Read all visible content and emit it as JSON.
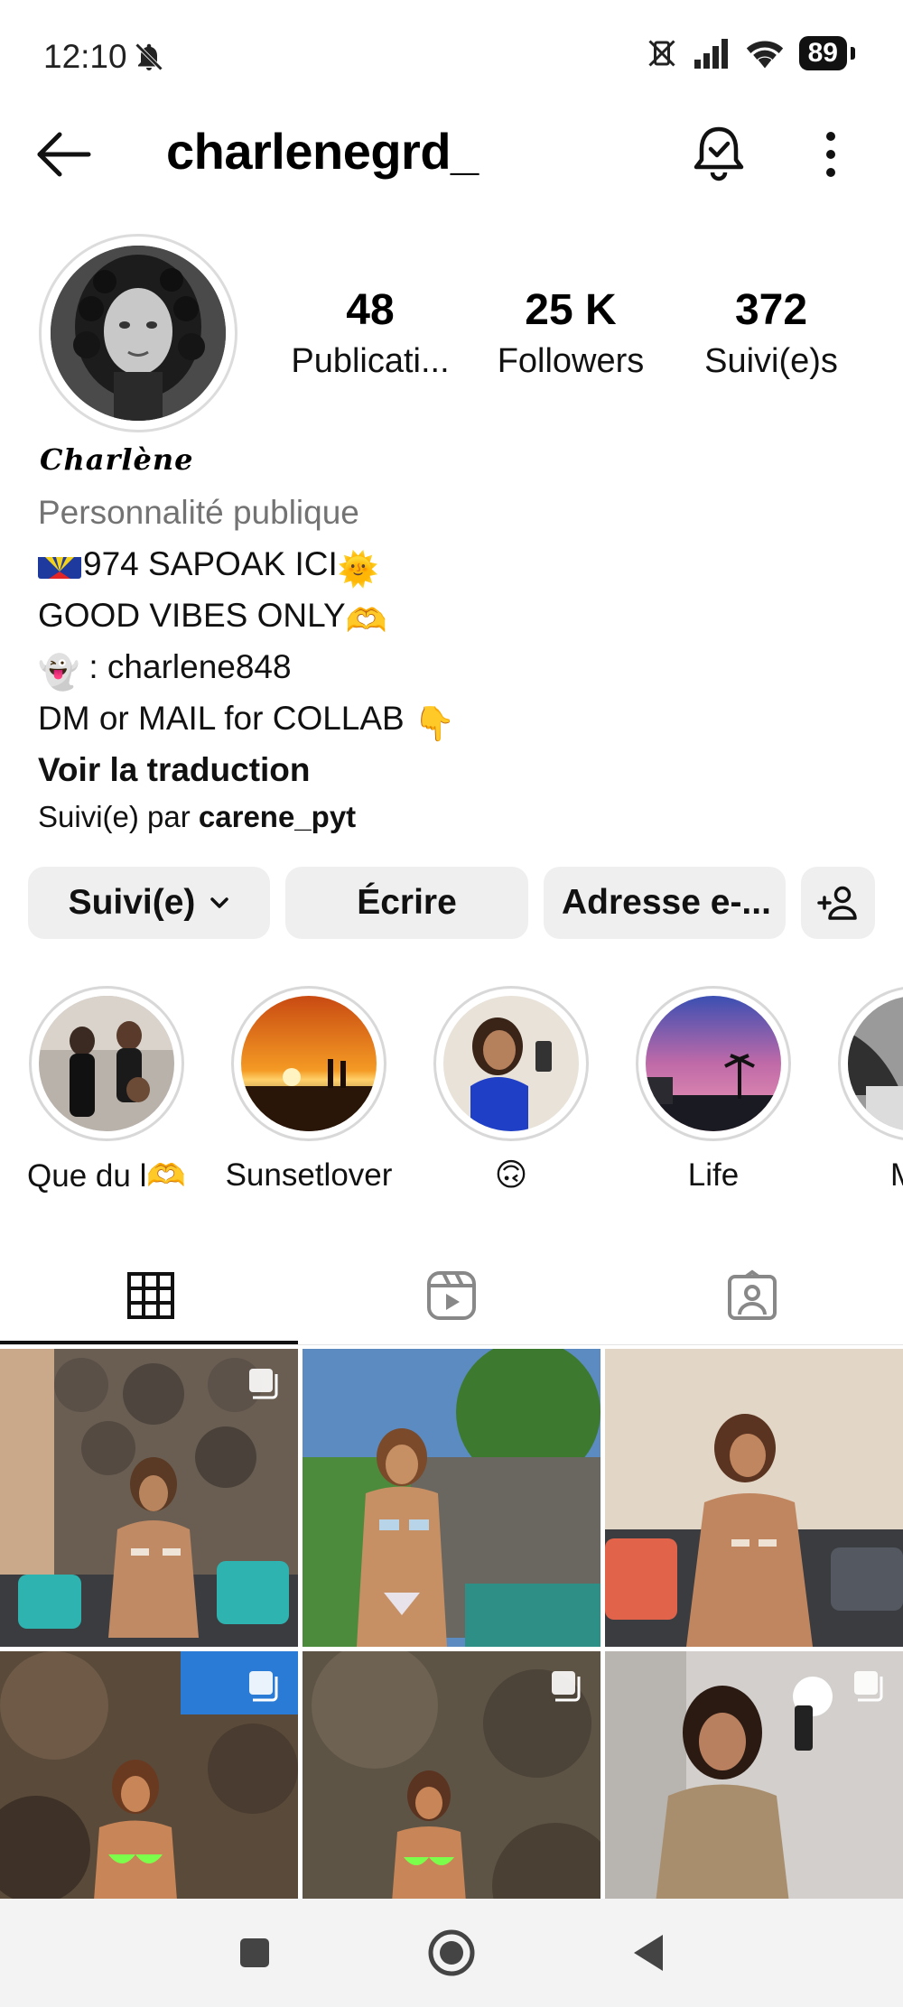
{
  "status_bar": {
    "time": "12:10",
    "battery": "89",
    "icons": [
      "notifications-muted-icon",
      "vibrate-icon",
      "signal-icon",
      "wifi-icon",
      "battery-icon"
    ]
  },
  "header": {
    "username": "charlenegrd_",
    "icons": [
      "back-arrow-icon",
      "bell-check-icon",
      "more-vertical-icon"
    ]
  },
  "profile": {
    "stats": [
      {
        "value": "48",
        "label": "Publicati..."
      },
      {
        "value": "25 K",
        "label": "Followers"
      },
      {
        "value": "372",
        "label": "Suivi(e)s"
      }
    ],
    "display_name": "Charlène",
    "category": "Personnalité publique",
    "bio_lines": [
      "974 SAPOAK ICI",
      "GOOD VIBES ONLY",
      " : charlene848",
      "DM or MAIL for COLLAB "
    ],
    "bio_emojis": [
      "🌞",
      "🫶",
      "👻",
      "👇"
    ],
    "translate_link": "Voir la traduction",
    "followed_by_prefix": "Suivi(e) par ",
    "followed_by_user": "carene_pyt"
  },
  "actions": {
    "follow_label": "Suivi(e)",
    "write_label": "Écrire",
    "mail_label": "Adresse e-...",
    "add_user_icon": "add-user-icon"
  },
  "highlights": [
    {
      "label": "Que du l🫶"
    },
    {
      "label": "Sunsetlover"
    },
    {
      "label": "🙃"
    },
    {
      "label": "Life"
    },
    {
      "label": "M"
    }
  ],
  "tabs": [
    {
      "icon": "grid-icon",
      "active": true
    },
    {
      "icon": "reels-icon",
      "active": false
    },
    {
      "icon": "tagged-icon",
      "active": false
    }
  ],
  "colors": {
    "button_bg": "#efefef",
    "category_text": "#737373",
    "active_tab": "#111111"
  },
  "navbar": {
    "icons": [
      "recents-square-icon",
      "home-circle-icon",
      "back-triangle-icon"
    ]
  }
}
